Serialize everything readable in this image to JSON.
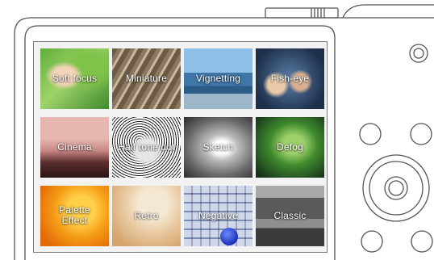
{
  "screen": {
    "tiles": [
      {
        "label": "Soft focus"
      },
      {
        "label": "Miniature"
      },
      {
        "label": "Vignetting"
      },
      {
        "label": "Fish-eye"
      },
      {
        "label": "Cinema"
      },
      {
        "label": "Half tone dot"
      },
      {
        "label": "Sketch"
      },
      {
        "label": "Defog"
      },
      {
        "label": "Palette\nEffect"
      },
      {
        "label": "Retro"
      },
      {
        "label": "Negative"
      },
      {
        "label": "Classic"
      }
    ]
  },
  "colors": {
    "outline": "#555555",
    "screen_border": "#7a7a7a"
  }
}
